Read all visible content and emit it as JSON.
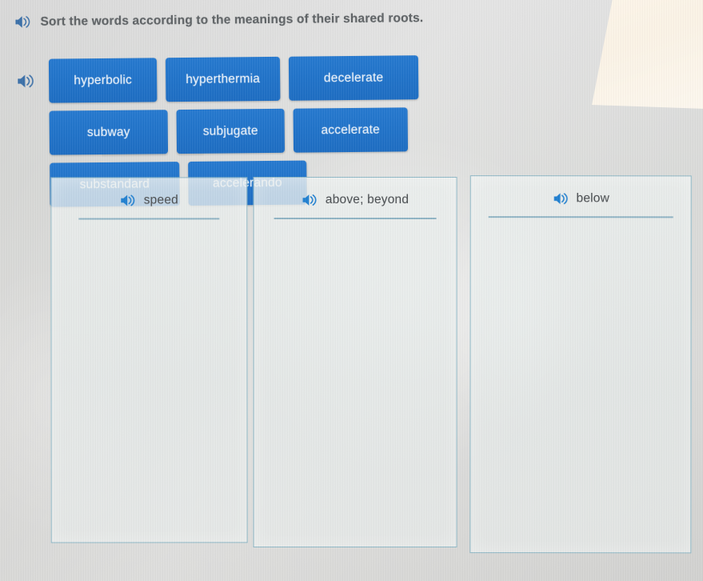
{
  "prompt": {
    "audio_icon": "speaker-icon",
    "text": "Sort the words according to the meanings of their shared roots."
  },
  "word_bank": {
    "audio_icon": "speaker-icon",
    "tiles": [
      {
        "label": "hyperbolic",
        "width_class": "w1"
      },
      {
        "label": "hyperthermia",
        "width_class": "w2"
      },
      {
        "label": "decelerate",
        "width_class": "w3"
      },
      {
        "label": "subway",
        "width_class": "w4"
      },
      {
        "label": "subjugate",
        "width_class": "w1"
      },
      {
        "label": "accelerate",
        "width_class": "w2"
      },
      {
        "label": "substandard",
        "width_class": "w3"
      },
      {
        "label": "accelerando",
        "width_class": "w4"
      }
    ]
  },
  "categories": [
    {
      "label": "speed",
      "audio_icon": "speaker-icon",
      "items": []
    },
    {
      "label": "above; beyond",
      "audio_icon": "speaker-icon",
      "items": []
    },
    {
      "label": "below",
      "audio_icon": "speaker-icon",
      "items": []
    }
  ],
  "colors": {
    "tile_blue": "#1f72c9",
    "tile_text": "#f2f7fc",
    "zone_border": "#8fb8c6",
    "zone_rule": "#7fa9bd",
    "prompt_text": "#5e6265",
    "label_text": "#4c5053",
    "page_background": "#d2d2d2",
    "speaker_icon": "#1f7fd0",
    "corner_glare": "#fdf6ea"
  }
}
